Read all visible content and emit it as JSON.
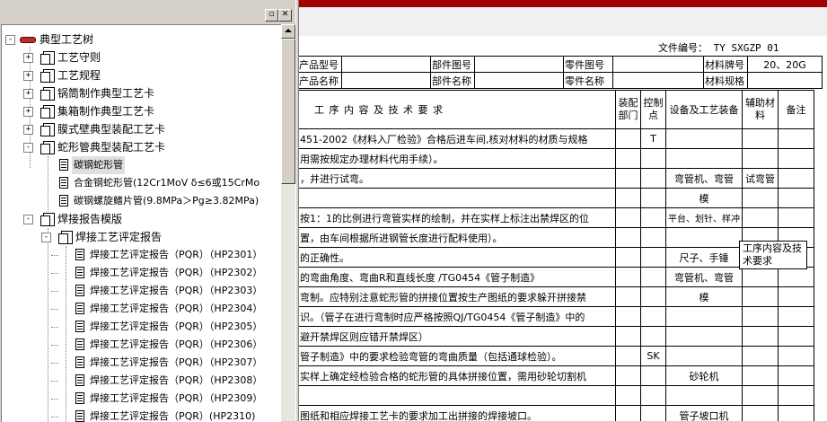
{
  "window": {
    "minimize_label": "▫",
    "close_label": "✕"
  },
  "tree": {
    "root": "典型工艺树",
    "level1": [
      "工艺守则",
      "工艺规程",
      "锅筒制作典型工艺卡",
      "集箱制作典型工艺卡",
      "膜式壁典型装配工艺卡",
      "蛇形管典型装配工艺卡"
    ],
    "serpentine_children": [
      "碳钢蛇形管",
      "合金钢蛇形管(12Cr1MoV δ≤6或15CrMo",
      "碳钢螺旋鳍片管(9.8MPa＞Pg≥3.82MPa)"
    ],
    "weld_template": "焊接报告模版",
    "weld_eval": "焊接工艺评定报告",
    "reports": [
      "焊接工艺评定报告（PQR）（HP2301）",
      "焊接工艺评定报告（PQR）（HP2302）",
      "焊接工艺评定报告（PQR）（HP2303）",
      "焊接工艺评定报告（PQR）（HP2304）",
      "焊接工艺评定报告（PQR）（HP2305）",
      "焊接工艺评定报告（PQR）（HP2306）",
      "焊接工艺评定报告（PQR）（HP2307）",
      "焊接工艺评定报告（PQR）（HP2308）",
      "焊接工艺评定报告（PQR）（HP2309）",
      "焊接工艺评定报告（PQR）(HP2310)"
    ]
  },
  "doc": {
    "file_no": "文件编号： TY   SXGZP   01",
    "header": {
      "product_model": "产品型号",
      "part_drawing_no": "部件图号",
      "component_drawing_no": "零件图号",
      "material_grade": "材料牌号",
      "material_grade_value": "20、20G",
      "product_name": "产品名称",
      "part_name": "部件名称",
      "component_name": "零件名称",
      "material_spec": "材料规格"
    },
    "columns": {
      "content": "工 序 内 容 及 技 术 要 求",
      "dept": "装配部门",
      "control": "控制点",
      "equipment": "设备及工艺装备",
      "aux": "辅助材料",
      "remark": "备注"
    },
    "rows": [
      {
        "content": "451-2002《材料入厂检验》合格后进车间,核对材料的材质与规格",
        "control": "T",
        "equipment": "",
        "aux": ""
      },
      {
        "content": "用需按规定办理材料代用手续）。",
        "control": "",
        "equipment": "",
        "aux": ""
      },
      {
        "content": "，并进行试弯。",
        "control": "",
        "equipment": "弯管机、弯管",
        "aux": "试弯管"
      },
      {
        "content": "",
        "control": "",
        "equipment": "模",
        "aux": ""
      },
      {
        "content": "按1：1的比例进行弯管实样的绘制，并在实样上标注出禁焊区的位",
        "control": "",
        "equipment": "平台、划针、样冲",
        "aux": ""
      },
      {
        "content": "置，由车间根据所进钢管长度进行配料使用）。",
        "control": "",
        "equipment": "",
        "aux": ""
      },
      {
        "content": "的正确性。",
        "control": "",
        "equipment": "尺子、手锤",
        "aux": ""
      },
      {
        "content": "的弯曲角度、弯曲R和直线长度                      /TG0454《管子制造》",
        "control": "",
        "equipment": "弯管机、弯管",
        "aux": ""
      },
      {
        "content": "弯制。应特别注意蛇形管的拼接位置按生产图纸的要求躲开拼接禁",
        "control": "",
        "equipment": "模",
        "aux": ""
      },
      {
        "content": "识。（管子在进行弯制时应严格按照QJ/TG0454《管子制造》中的",
        "control": "",
        "equipment": "",
        "aux": ""
      },
      {
        "content": "避开禁焊区则应错开禁焊区）",
        "control": "",
        "equipment": "",
        "aux": ""
      },
      {
        "content": "管子制造》中的要求检验弯管的弯曲质量（包括通球检验）。",
        "control": "SK",
        "equipment": "",
        "aux": ""
      },
      {
        "content": "实样上确定经检验合格的蛇形管的具体拼接位置，需用砂轮切割机",
        "control": "",
        "equipment": "砂轮机",
        "aux": ""
      },
      {
        "content": "",
        "control": "",
        "equipment": "",
        "aux": ""
      },
      {
        "content": "图纸和相应焊接工艺卡的要求加工出拼接的焊接坡口。",
        "control": "",
        "equipment": "管子坡口机",
        "aux": ""
      }
    ],
    "tooltip": "工序内容及技术要求"
  }
}
